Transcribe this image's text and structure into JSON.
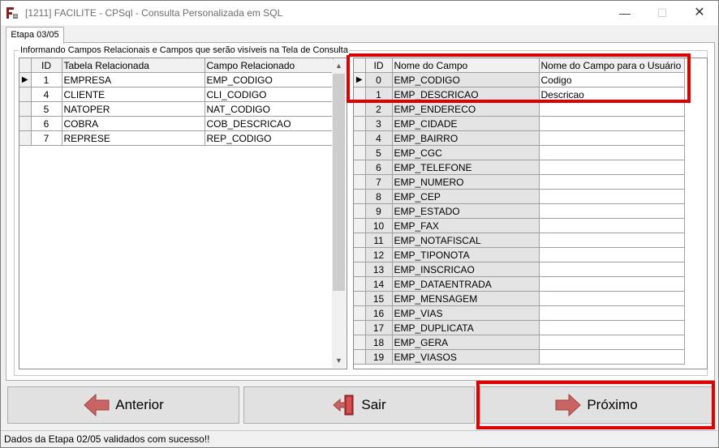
{
  "window": {
    "title": "[1211] FACILITE - CPSql - Consulta Personalizada em SQL",
    "minimize_glyph": "—",
    "maximize_glyph": "☐",
    "close_glyph": "✕"
  },
  "tab": {
    "label": "Etapa 03/05"
  },
  "group": {
    "label": "Informando Campos Relacionais e Campos que serão visíveis na Tela de Consulta"
  },
  "left_grid": {
    "headers": {
      "id": "ID",
      "table": "Tabela Relacionada",
      "field": "Campo Relacionado"
    },
    "rows": [
      {
        "id": "1",
        "table": "EMPRESA",
        "field": "EMP_CODIGO"
      },
      {
        "id": "4",
        "table": "CLIENTE",
        "field": "CLI_CODIGO"
      },
      {
        "id": "5",
        "table": "NATOPER",
        "field": "NAT_CODIGO"
      },
      {
        "id": "6",
        "table": "COBRA",
        "field": "COB_DESCRICAO"
      },
      {
        "id": "7",
        "table": "REPRESE",
        "field": "REP_CODIGO"
      }
    ]
  },
  "right_grid": {
    "headers": {
      "id": "ID",
      "name": "Nome do Campo",
      "user_name": "Nome do Campo para o Usuário"
    },
    "rows": [
      {
        "id": "0",
        "name": "EMP_CODIGO",
        "user_name": "Codigo"
      },
      {
        "id": "1",
        "name": "EMP_DESCRICAO",
        "user_name": "Descricao"
      },
      {
        "id": "2",
        "name": "EMP_ENDERECO",
        "user_name": ""
      },
      {
        "id": "3",
        "name": "EMP_CIDADE",
        "user_name": ""
      },
      {
        "id": "4",
        "name": "EMP_BAIRRO",
        "user_name": ""
      },
      {
        "id": "5",
        "name": "EMP_CGC",
        "user_name": ""
      },
      {
        "id": "6",
        "name": "EMP_TELEFONE",
        "user_name": ""
      },
      {
        "id": "7",
        "name": "EMP_NUMERO",
        "user_name": ""
      },
      {
        "id": "8",
        "name": "EMP_CEP",
        "user_name": ""
      },
      {
        "id": "9",
        "name": "EMP_ESTADO",
        "user_name": ""
      },
      {
        "id": "10",
        "name": "EMP_FAX",
        "user_name": ""
      },
      {
        "id": "11",
        "name": "EMP_NOTAFISCAL",
        "user_name": ""
      },
      {
        "id": "12",
        "name": "EMP_TIPONOTA",
        "user_name": ""
      },
      {
        "id": "13",
        "name": "EMP_INSCRICAO",
        "user_name": ""
      },
      {
        "id": "14",
        "name": "EMP_DATAENTRADA",
        "user_name": ""
      },
      {
        "id": "15",
        "name": "EMP_MENSAGEM",
        "user_name": ""
      },
      {
        "id": "16",
        "name": "EMP_VIAS",
        "user_name": ""
      },
      {
        "id": "17",
        "name": "EMP_DUPLICATA",
        "user_name": ""
      },
      {
        "id": "18",
        "name": "EMP_GERA",
        "user_name": ""
      },
      {
        "id": "19",
        "name": "EMP_VIASOS",
        "user_name": ""
      }
    ]
  },
  "buttons": {
    "previous": "Anterior",
    "exit": "Sair",
    "next": "Próximo"
  },
  "icons": {
    "previous": "arrow-left-icon",
    "exit": "exit-door-icon",
    "next": "arrow-right-icon"
  },
  "colors": {
    "highlight": "#e00000",
    "arrow": "#c86464",
    "arrow_edge": "#a04040"
  },
  "status": {
    "text": "Dados da Etapa 02/05 validados com sucesso!!"
  }
}
